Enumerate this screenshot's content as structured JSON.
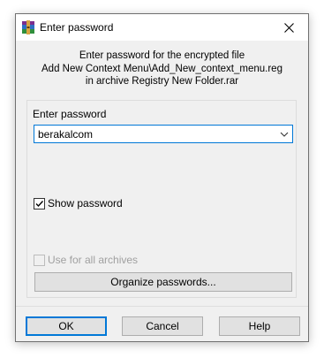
{
  "window": {
    "title": "Enter password",
    "app_icon": "winrar-icon",
    "close_icon": "close-icon"
  },
  "intro": {
    "line1": "Enter password for the encrypted file",
    "line2": "Add New Context Menu\\Add_New_context_menu.reg",
    "line3": "in archive Registry New Folder.rar"
  },
  "password": {
    "label": "Enter password",
    "value": "berakalcom",
    "dropdown_icon": "chevron-down-icon"
  },
  "show_password": {
    "label": "Show password",
    "checked": true
  },
  "use_for_all": {
    "label": "Use for all archives",
    "checked": false,
    "enabled": false
  },
  "organize_button": "Organize passwords...",
  "buttons": {
    "ok": "OK",
    "cancel": "Cancel",
    "help": "Help"
  },
  "colors": {
    "accent": "#0078d7",
    "dialog_bg": "#f0f0f0",
    "button_bg": "#e1e1e1"
  }
}
